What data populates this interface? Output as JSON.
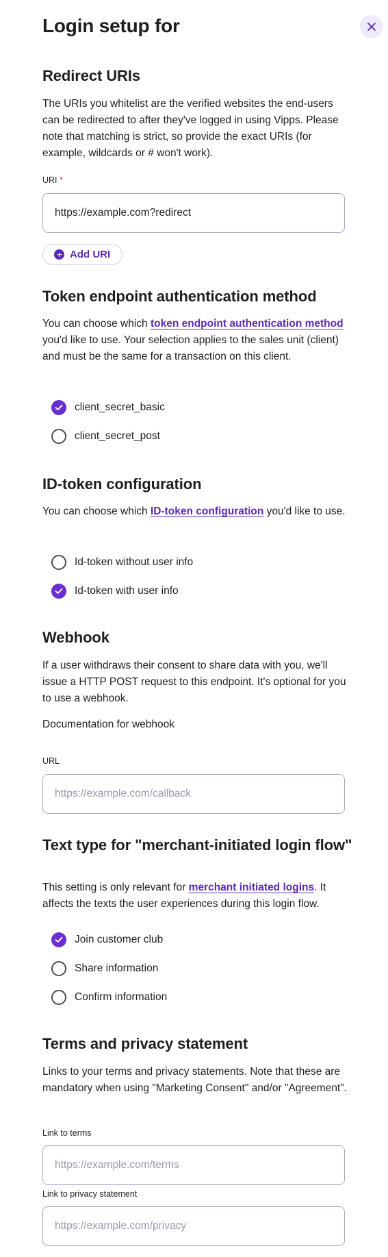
{
  "header": {
    "title": "Login setup for"
  },
  "redirect": {
    "heading": "Redirect URIs",
    "description": "The URIs you whitelist are the verified websites the end-users can be redirected to after they've logged in using Vipps. Please note that matching is strict, so provide the exact URIs (for example, wildcards or # won't work).",
    "uri_label": "URI",
    "required_mark": " *",
    "uri_value": "https://example.com?redirect",
    "add_label": "Add URI"
  },
  "token": {
    "heading": "Token endpoint authentication method",
    "desc_pre": "You can choose which ",
    "desc_link": "token endpoint authentication method",
    "desc_post": " you'd like to use. Your selection applies to the sales unit (client) and must be the same for a transaction on this client.",
    "options": [
      {
        "label": "client_secret_basic",
        "checked": true
      },
      {
        "label": "client_secret_post",
        "checked": false
      }
    ]
  },
  "idtoken": {
    "heading": "ID-token configuration",
    "desc_pre": "You can choose which ",
    "desc_link": "ID-token configuration",
    "desc_post": " you'd like to use.",
    "options": [
      {
        "label": "Id-token without user info",
        "checked": false
      },
      {
        "label": "Id-token with user info",
        "checked": true
      }
    ]
  },
  "webhook": {
    "heading": "Webhook",
    "description": "If a user withdraws their consent to share data with you, we'll issue a HTTP POST request to this endpoint. It's optional for you to use a webhook.",
    "doc_text": "Documentation for webhook",
    "url_label": "URL",
    "url_placeholder": "https://example.com/callback"
  },
  "texttype": {
    "heading": "Text type for \"merchant-initiated login flow\"",
    "desc_pre": "This setting is only relevant for ",
    "desc_link": "merchant initiated logins",
    "desc_post": ". It affects the texts the user experiences during this login flow.",
    "options": [
      {
        "label": "Join customer club",
        "checked": true
      },
      {
        "label": "Share information",
        "checked": false
      },
      {
        "label": "Confirm information",
        "checked": false
      }
    ]
  },
  "terms": {
    "heading": "Terms and privacy statement",
    "description": "Links to your terms and privacy statements. Note that these are mandatory when using \"Marketing Consent\" and/or \"Agreement\".",
    "terms_label": "Link to terms",
    "terms_placeholder": "https://example.com/terms",
    "privacy_label": "Link to privacy statement",
    "privacy_placeholder": "https://example.com/privacy"
  },
  "colors": {
    "accent": "#6a2ed0",
    "link": "#5b2bb5",
    "close_bg": "#efeafc"
  },
  "icons": {
    "close": "close-icon",
    "add": "plus-circle-icon",
    "check": "check-icon"
  }
}
